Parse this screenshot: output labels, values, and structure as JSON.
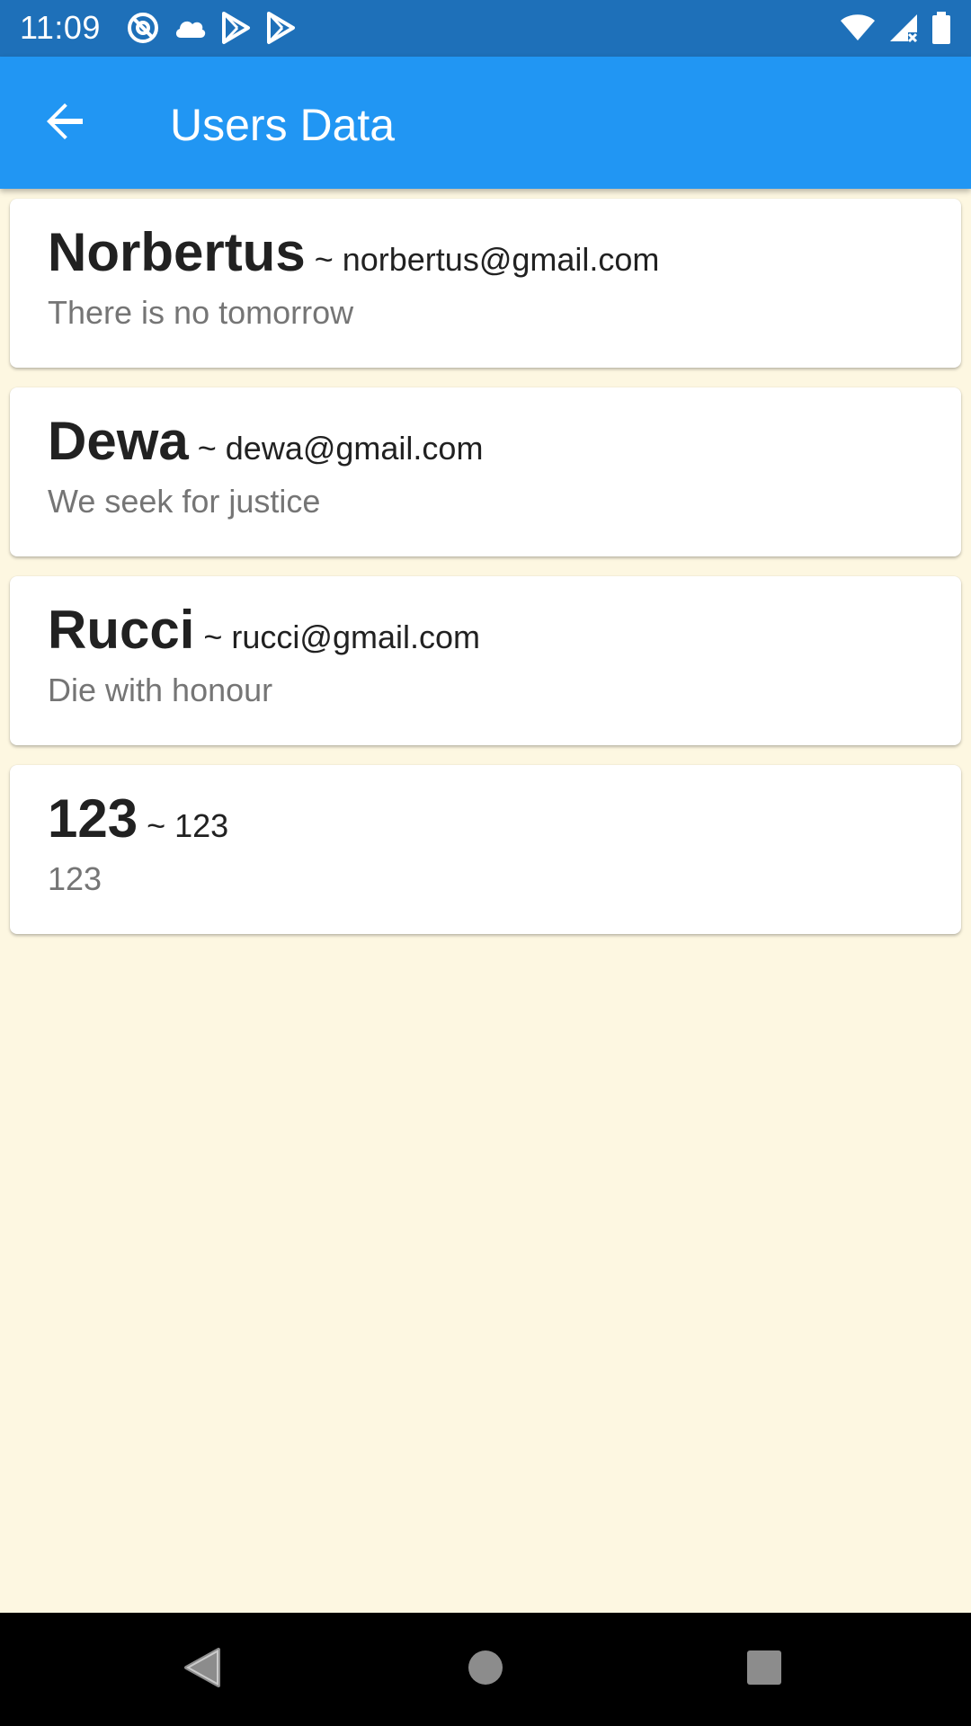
{
  "status_bar": {
    "time": "11:09",
    "left_icons": [
      "at-sign-icon",
      "cloud-icon",
      "play-store-icon",
      "play-store-icon"
    ],
    "right_icons": [
      "wifi-icon",
      "cell-signal-icon",
      "battery-icon"
    ]
  },
  "app_bar": {
    "back_icon": "arrow-back-icon",
    "title": "Users Data",
    "color": "#2196F3"
  },
  "users": [
    {
      "name": "Norbertus",
      "separator": " ~ ",
      "email": "norbertus@gmail.com",
      "motto": "There is no tomorrow"
    },
    {
      "name": "Dewa",
      "separator": " ~ ",
      "email": "dewa@gmail.com",
      "motto": "We seek for justice"
    },
    {
      "name": "Rucci",
      "separator": " ~ ",
      "email": "rucci@gmail.com",
      "motto": "Die with honour"
    },
    {
      "name": "123",
      "separator": " ~ ",
      "email": "123",
      "motto": "123"
    }
  ],
  "nav_bar": {
    "buttons": [
      "back-triangle-icon",
      "home-circle-icon",
      "recents-square-icon"
    ]
  },
  "colors": {
    "status_bar": "#1E70B9",
    "background": "#FDF7E1",
    "card": "#FFFFFF",
    "secondary_text": "#757575"
  }
}
